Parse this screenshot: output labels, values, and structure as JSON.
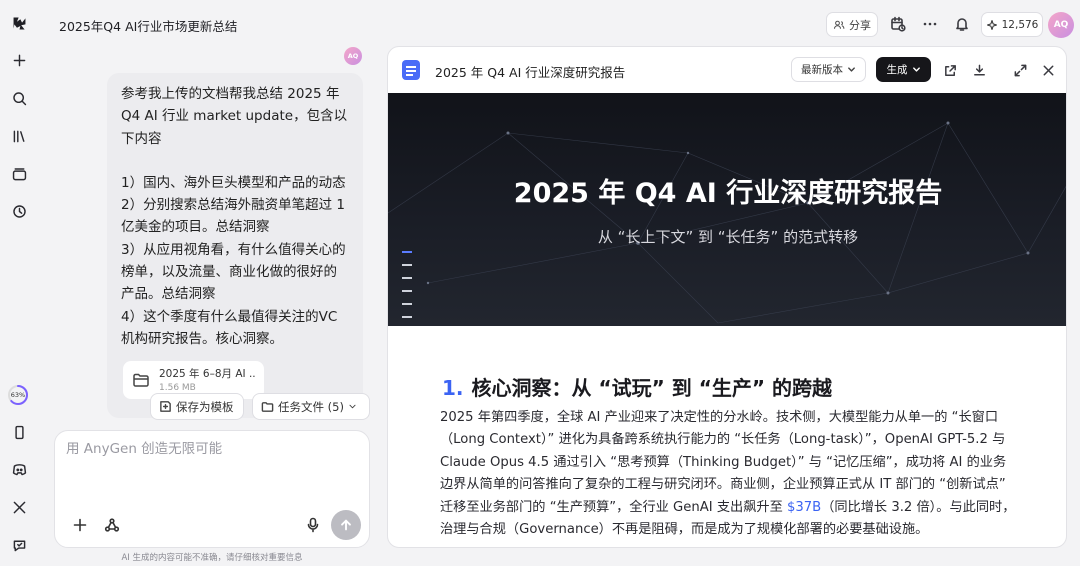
{
  "rail": {
    "icons": [
      "app-logo-icon",
      "plus-icon",
      "search-icon",
      "library-icon",
      "layers-icon",
      "history-icon"
    ],
    "progress_label": "63%",
    "progress_value": 0.63,
    "bottom_icons": [
      "phone-icon",
      "discord-icon",
      "x-logo-icon",
      "feedback-icon"
    ]
  },
  "topbar": {
    "title": "2025年Q4 AI行业市场更新总结",
    "share_label": "分享",
    "credits": "12,576",
    "avatar": "AQ"
  },
  "chat": {
    "avatar": "AQ",
    "message_lines": [
      "参考我上传的文档帮我总结 2025 年",
      "Q4 AI 行业 market update，包含以",
      "下内容",
      "",
      "1）国内、海外巨头模型和产品的动态",
      "2）分别搜索总结海外融资单笔超过 1",
      "亿美金的项目。总结洞察",
      "3）从应用视角看，有什么值得关心的",
      "榜单，以及流量、商业化做的很好的",
      "产品。总结洞察",
      "4）这个季度有什么最值得关注的VC",
      "机构研究报告。核心洞察。"
    ],
    "file": {
      "name": "2025 年 6–8月 AI ...",
      "size": "1.56 MB"
    },
    "save_template_label": "保存为模板",
    "task_files_label": "任务文件 (5)",
    "composer_placeholder": "用 AnyGen 创造无限可能",
    "disclaimer": "AI 生成的内容可能不准确，请仔细核对重要信息"
  },
  "doc": {
    "title": "2025 年 Q4 AI 行业深度研究报告",
    "version_label": "最新版本",
    "generate_label": "生成",
    "hero_title": "2025 年 Q4 AI 行业深度研究报告",
    "hero_subtitle": "从 “长上下文” 到 “长任务” 的范式转移",
    "section_number": "1.",
    "section_title": "核心洞察：从 “试玩” 到 “生产” 的跨越",
    "body_before": "2025 年第四季度，全球 AI 产业迎来了决定性的分水岭。技术侧，大模型能力从单一的 “长窗口（Long Context）” 进化为具备跨系统执行能力的 “长任务（Long-task）”，OpenAI GPT-5.2 与 Claude Opus 4.5 通过引入 “思考预算（Thinking Budget）” 与 “记忆压缩”，成功将 AI 的业务边界从简单的问答推向了复杂的工程与研究闭环。商业侧，企业预算正式从 IT 部门的 “创新试点” 迁移至业务部门的 “生产预算”，全行业 GenAI 支出飙升至 ",
    "body_highlight": "$37B",
    "body_after": "（同比增长 3.2 倍）。与此同时，治理与合规（Governance）不再是阻碍，而是成为了规模化部署的必要基础设施。"
  },
  "colors": {
    "accent": "#3b63f3",
    "hero_bg": "#15171e",
    "generate_bg": "#16161a"
  }
}
